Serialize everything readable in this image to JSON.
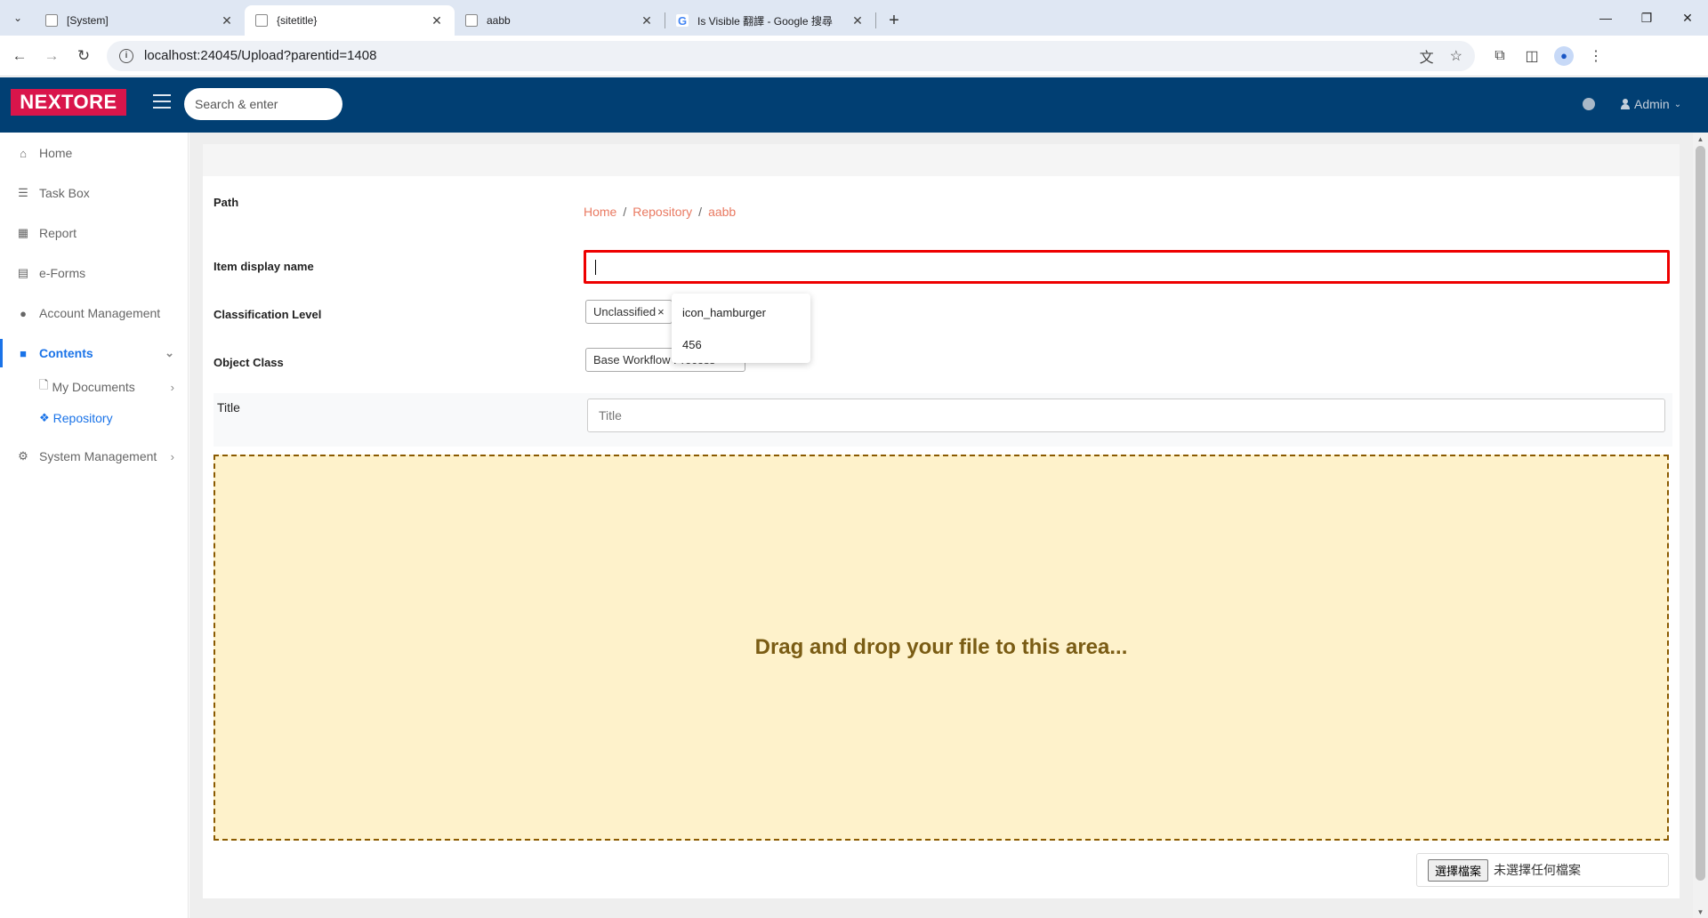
{
  "browser": {
    "tabs": [
      {
        "title": "[System]"
      },
      {
        "title": "{sitetitle}"
      },
      {
        "title": "aabb"
      },
      {
        "title": "Is Visible 翻譯 - Google 搜尋"
      }
    ],
    "active_tab": 1,
    "url": "localhost:24045/Upload?parentid=1408"
  },
  "header": {
    "logo": "NEXTORE",
    "search_placeholder": "Search & enter",
    "user": "Admin"
  },
  "sidebar": {
    "items": [
      {
        "label": "Home",
        "icon": "home-icon"
      },
      {
        "label": "Task Box",
        "icon": "tasks-icon"
      },
      {
        "label": "Report",
        "icon": "table-icon"
      },
      {
        "label": "e-Forms",
        "icon": "form-icon"
      },
      {
        "label": "Account Management",
        "icon": "user-icon"
      },
      {
        "label": "Contents",
        "icon": "folder-icon"
      },
      {
        "label": "System Management",
        "icon": "cogs-icon"
      }
    ],
    "sub_items": [
      {
        "label": "My Documents",
        "icon": "file-icon"
      },
      {
        "label": "Repository",
        "icon": "dropbox-icon"
      }
    ],
    "active": "Repository"
  },
  "form": {
    "path_label": "Path",
    "breadcrumb": [
      "Home",
      "Repository",
      "aabb"
    ],
    "name_label": "Item display name",
    "name_value": "",
    "classification_label": "Classification Level",
    "classification_value": "Unclassified",
    "object_class_label": "Object Class",
    "object_class_value": "Base Workflow Process",
    "title_label": "Title",
    "title_placeholder": "Title",
    "dropdown_options": [
      "icon_hamburger",
      "456"
    ],
    "dropzone_text": "Drag and drop your file to this area...",
    "file_button": "選擇檔案",
    "file_status": "未選擇任何檔案"
  },
  "colors": {
    "header_bg": "#013f73",
    "logo_bg": "#d9154b",
    "accent": "#1a73e8",
    "breadcrumb": "#e97a62",
    "error_border": "#ee0000",
    "dropzone_bg": "#fef2cb"
  }
}
